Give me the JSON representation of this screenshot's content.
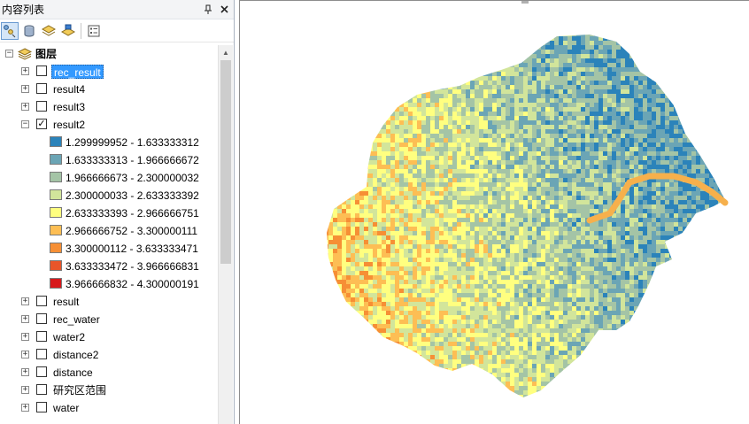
{
  "panel": {
    "title": "内容列表",
    "pin_icon": "pin-icon",
    "close_icon": "close-icon",
    "tools": [
      "list-by-drawing-order-icon",
      "list-by-source-icon",
      "list-by-visibility-icon",
      "list-by-selection-icon",
      "options-icon"
    ]
  },
  "tree": {
    "root_label": "图层",
    "layers_top": [
      {
        "name": "rec_result",
        "checked": false,
        "selected": true
      },
      {
        "name": "result4",
        "checked": false,
        "selected": false
      },
      {
        "name": "result3",
        "checked": false,
        "selected": false
      },
      {
        "name": "result2",
        "checked": true,
        "selected": false,
        "expanded": true
      }
    ],
    "legend": [
      {
        "label": "1.299999952 - 1.633333312",
        "color": "#2b83ba"
      },
      {
        "label": "1.633333313 - 1.966666672",
        "color": "#6ba5b5"
      },
      {
        "label": "1.966666673 - 2.300000032",
        "color": "#a4c4a6"
      },
      {
        "label": "2.300000033 - 2.633333392",
        "color": "#d2e59b"
      },
      {
        "label": "2.633333393 - 2.966666751",
        "color": "#ffff80"
      },
      {
        "label": "2.966666752 - 3.300000111",
        "color": "#fdbe54"
      },
      {
        "label": "3.300000112 - 3.633333471",
        "color": "#f68f35"
      },
      {
        "label": "3.633333472 - 3.966666831",
        "color": "#e9552a"
      },
      {
        "label": "3.966666832 - 4.300000191",
        "color": "#d7191c"
      }
    ],
    "layers_bottom": [
      {
        "name": "result",
        "checked": false
      },
      {
        "name": "rec_water",
        "checked": false
      },
      {
        "name": "water2",
        "checked": false
      },
      {
        "name": "distance2",
        "checked": false
      },
      {
        "name": "distance",
        "checked": false
      },
      {
        "name": "研究区范围",
        "checked": false
      },
      {
        "name": "water",
        "checked": false
      }
    ]
  },
  "map": {
    "layer_shown": "result2",
    "palette": [
      "#2b83ba",
      "#6ba5b5",
      "#a4c4a6",
      "#d2e59b",
      "#ffff80",
      "#fdbe54",
      "#f68f35",
      "#e9552a",
      "#d7191c"
    ],
    "river_color": "#f6b04c"
  }
}
